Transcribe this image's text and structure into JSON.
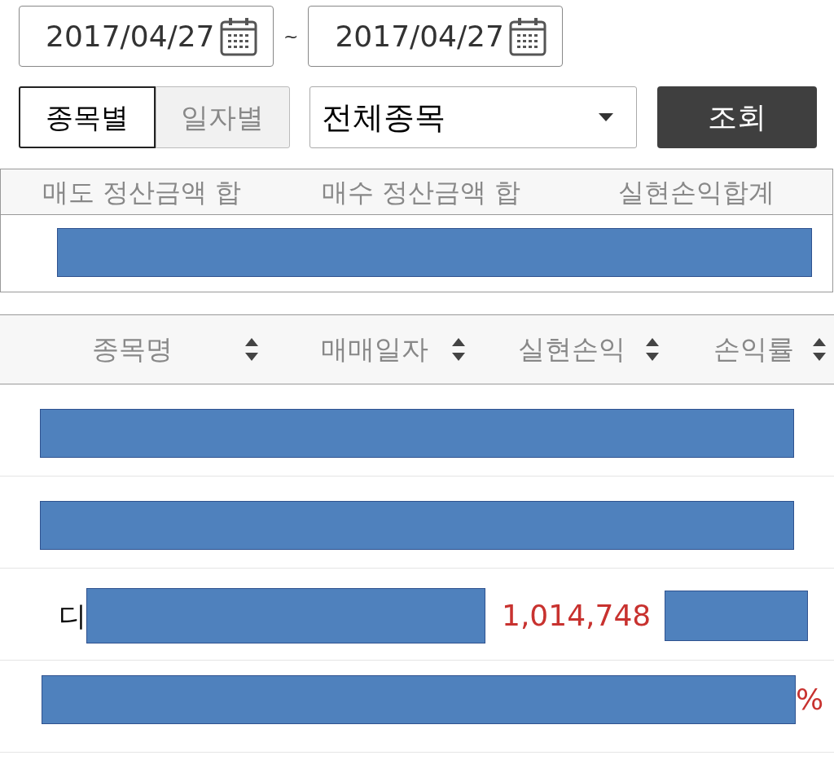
{
  "date_range": {
    "from": "2017/04/27",
    "separator": "~",
    "to": "2017/04/27"
  },
  "view_toggle": [
    {
      "label": "종목별",
      "selected": true
    },
    {
      "label": "일자별",
      "selected": false
    }
  ],
  "stock_select": {
    "value": "전체종목"
  },
  "search_button": "조회",
  "summary": {
    "columns": [
      "매도 정산금액 합",
      "매수 정산금액 합",
      "실현손익합계"
    ]
  },
  "list": {
    "columns": [
      "종목명",
      "매매일자",
      "실현손익",
      "손익률"
    ],
    "rows": [
      {
        "kind": "redacted"
      },
      {
        "kind": "redacted"
      },
      {
        "kind": "name_profit",
        "name": "디",
        "profit": "1,014,748"
      },
      {
        "kind": "rate",
        "rate": "%"
      }
    ]
  }
}
